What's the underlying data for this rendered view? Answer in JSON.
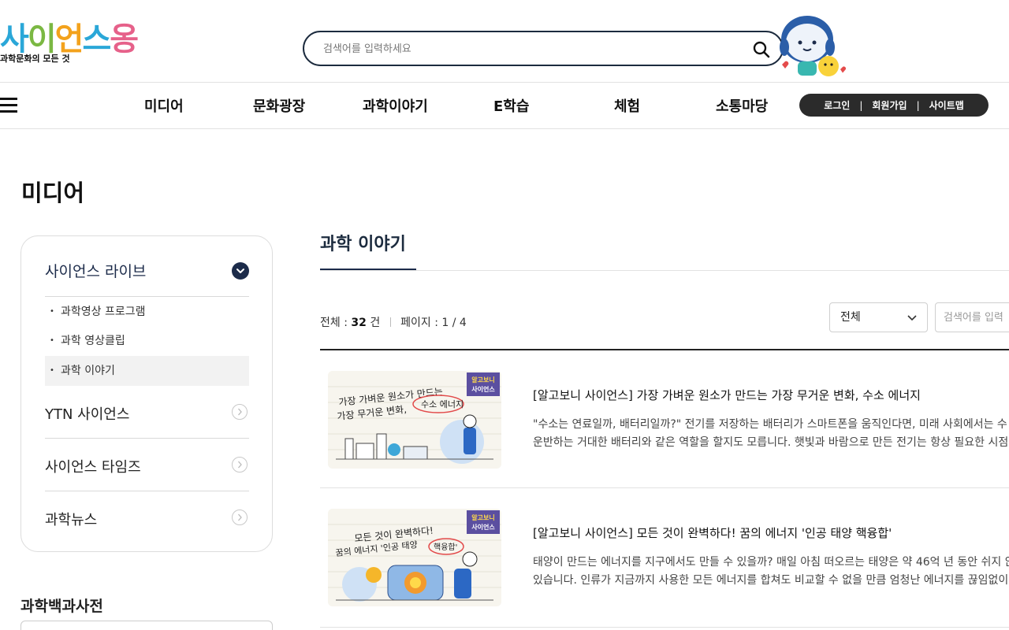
{
  "header": {
    "logo": {
      "word": [
        "사",
        "이",
        "언",
        "스",
        "옹"
      ],
      "subtitle": "과학문화의 모든 것"
    },
    "search": {
      "placeholder": "검색어를 입력하세요"
    }
  },
  "gnb": {
    "items": [
      "미디어",
      "문화광장",
      "과학이야기",
      "E학습",
      "체험",
      "소통마당"
    ],
    "util": [
      "로그인",
      "회원가입",
      "사이트맵"
    ]
  },
  "page": {
    "title": "미디어"
  },
  "lnb": {
    "main": "사이언스 라이브",
    "sub": [
      "과학영상 프로그램",
      "과학 영상클립",
      "과학 이야기"
    ],
    "rows": [
      "YTN 사이언스",
      "사이언스 타임즈",
      "과학뉴스"
    ]
  },
  "dictionary": {
    "title": "과학백과사전"
  },
  "content": {
    "title": "과학 이야기",
    "count": {
      "total_label": "전체 :",
      "total_value": "32",
      "unit": "건",
      "page_label": "페이지 :",
      "page_value": "1 / 4"
    },
    "filter": "전체",
    "search_placeholder": "검색어를 입력",
    "items": [
      {
        "title": "[알고보니 사이언스] 가장 가벼운 원소가 만드는 가장 무거운 변화, 수소 에너지",
        "desc1": "\"수소는 연료일까, 배터리일까?\" 전기를 저장하는 배터리가 스마트폰을 움직인다면, 미래 사회에서는 수",
        "desc2": "운반하는 거대한 배터리와 같은 역할을 할지도 모릅니다. 햇빛과 바람으로 만든 전기는 항상 필요한 시점",
        "thumb_line1": "가장 가벼운 원소가 만드는",
        "thumb_line2": "가장 무거운 변화,",
        "thumb_highlight": "수소 에너지"
      },
      {
        "title": "[알고보니 사이언스] 모든 것이 완벽하다! 꿈의 에너지 '인공 태양 핵융합'",
        "desc1": "태양이 만드는 에너지를 지구에서도 만들 수 있을까? 매일 아침 떠오르는 태양은 약 46억 년 동안 쉬지 않",
        "desc2": "있습니다. 인류가 지금까지 사용한 모든 에너지를 합쳐도 비교할 수 없을 만큼 엄청난 에너지를 끊임없이",
        "thumb_line1": "모든 것이 완벽하다!",
        "thumb_line2": "꿈의 에너지 '인공 태양",
        "thumb_highlight": "핵융합'"
      }
    ],
    "badge_lines": [
      "알고보니",
      "사이언스"
    ]
  }
}
